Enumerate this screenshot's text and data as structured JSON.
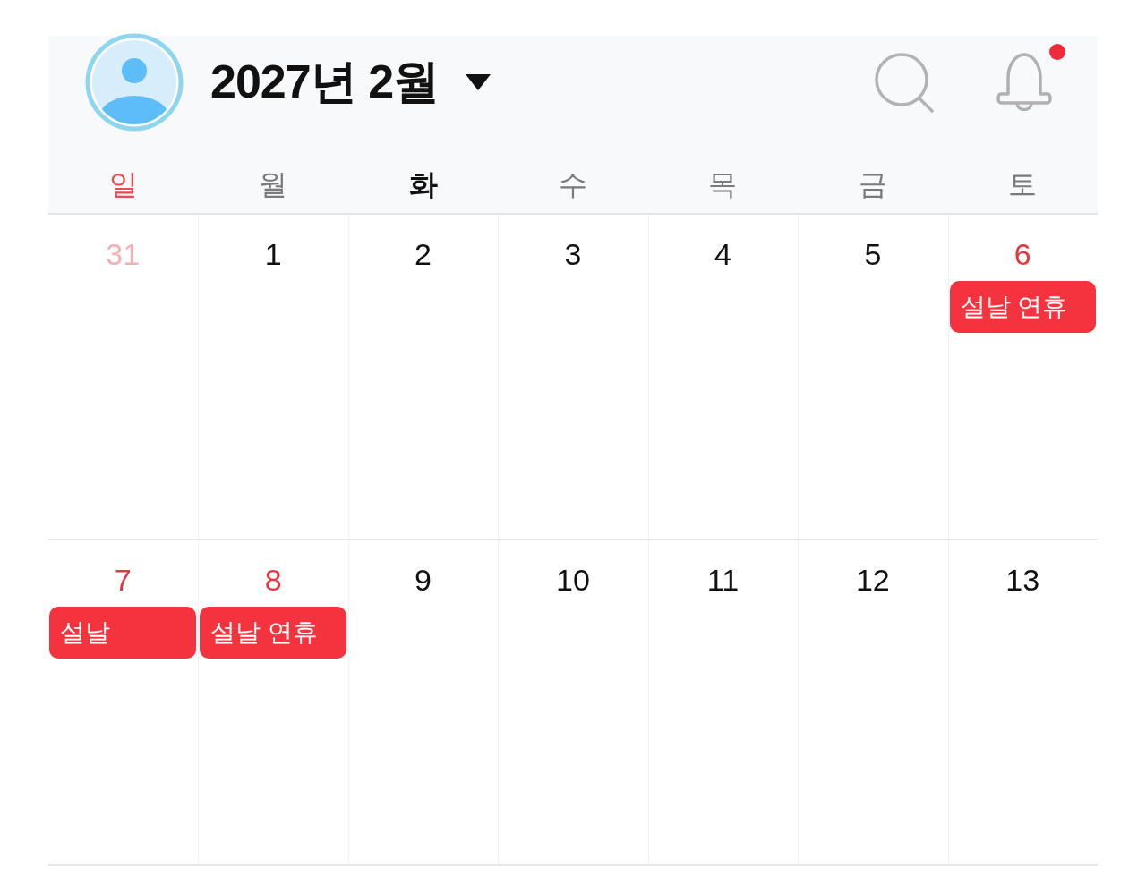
{
  "header": {
    "title": "2027년 2월",
    "has_unread_notifications": true
  },
  "weekdays": [
    {
      "label": "일",
      "kind": "sunday",
      "today": false
    },
    {
      "label": "월",
      "kind": "weekday",
      "today": false
    },
    {
      "label": "화",
      "kind": "weekday",
      "today": true
    },
    {
      "label": "수",
      "kind": "weekday",
      "today": false
    },
    {
      "label": "목",
      "kind": "weekday",
      "today": false
    },
    {
      "label": "금",
      "kind": "weekday",
      "today": false
    },
    {
      "label": "토",
      "kind": "weekday",
      "today": false
    }
  ],
  "weeks": [
    {
      "days": [
        {
          "date": "31",
          "holiday": true,
          "outside_month": true
        },
        {
          "date": "1",
          "holiday": false,
          "outside_month": false
        },
        {
          "date": "2",
          "holiday": false,
          "outside_month": false
        },
        {
          "date": "3",
          "holiday": false,
          "outside_month": false
        },
        {
          "date": "4",
          "holiday": false,
          "outside_month": false
        },
        {
          "date": "5",
          "holiday": false,
          "outside_month": false
        },
        {
          "date": "6",
          "holiday": true,
          "outside_month": false,
          "events": [
            {
              "title": "설날 연휴"
            }
          ]
        }
      ]
    },
    {
      "days": [
        {
          "date": "7",
          "holiday": true,
          "outside_month": false,
          "events": [
            {
              "title": "설날"
            }
          ]
        },
        {
          "date": "8",
          "holiday": true,
          "outside_month": false,
          "events": [
            {
              "title": "설날 연휴"
            }
          ]
        },
        {
          "date": "9",
          "holiday": false,
          "outside_month": false
        },
        {
          "date": "10",
          "holiday": false,
          "outside_month": false
        },
        {
          "date": "11",
          "holiday": false,
          "outside_month": false
        },
        {
          "date": "12",
          "holiday": false,
          "outside_month": false
        },
        {
          "date": "13",
          "holiday": false,
          "outside_month": false
        }
      ]
    }
  ]
}
